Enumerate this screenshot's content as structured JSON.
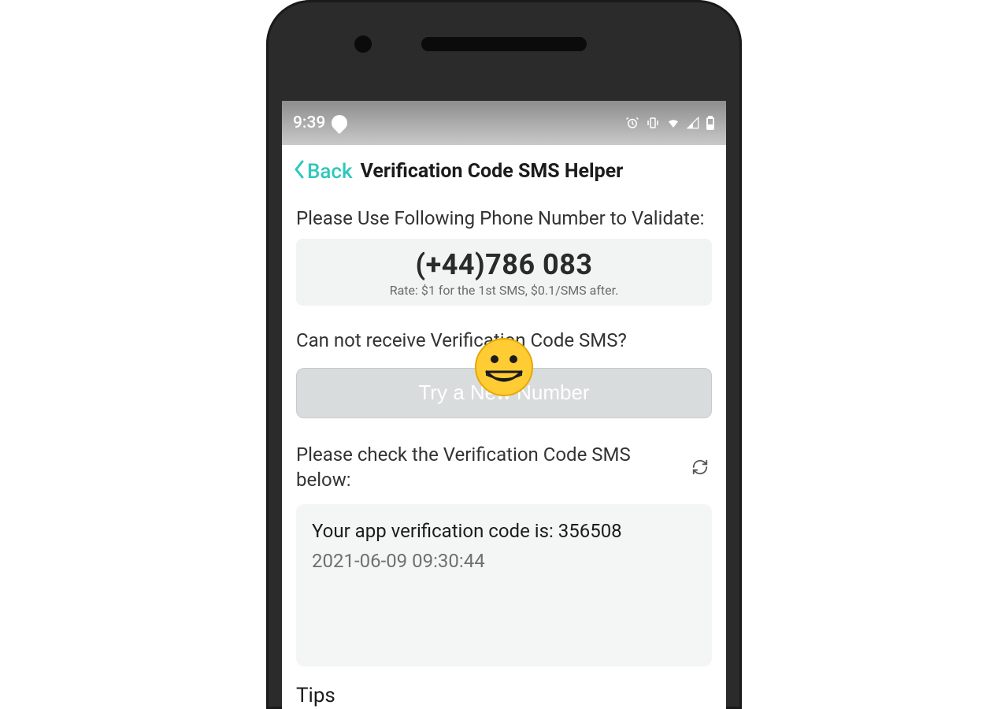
{
  "statusbar": {
    "time": "9:39"
  },
  "appbar": {
    "back_label": "Back",
    "title": "Verification Code SMS Helper"
  },
  "validate_label": "Please Use Following Phone Number to Validate:",
  "phone_number_visible": "(+44)786      083",
  "rate": "Rate: $1 for the 1st SMS, $0.1/SMS after.",
  "cannot_receive_label": "Can not receive Verification Code SMS?",
  "try_button": "Try a New Number",
  "check_label": "Please check the Verification Code SMS below:",
  "sms": {
    "text": "Your app verification code is: 356508",
    "time": "2021-06-09 09:30:44"
  },
  "tips_label": "Tips"
}
